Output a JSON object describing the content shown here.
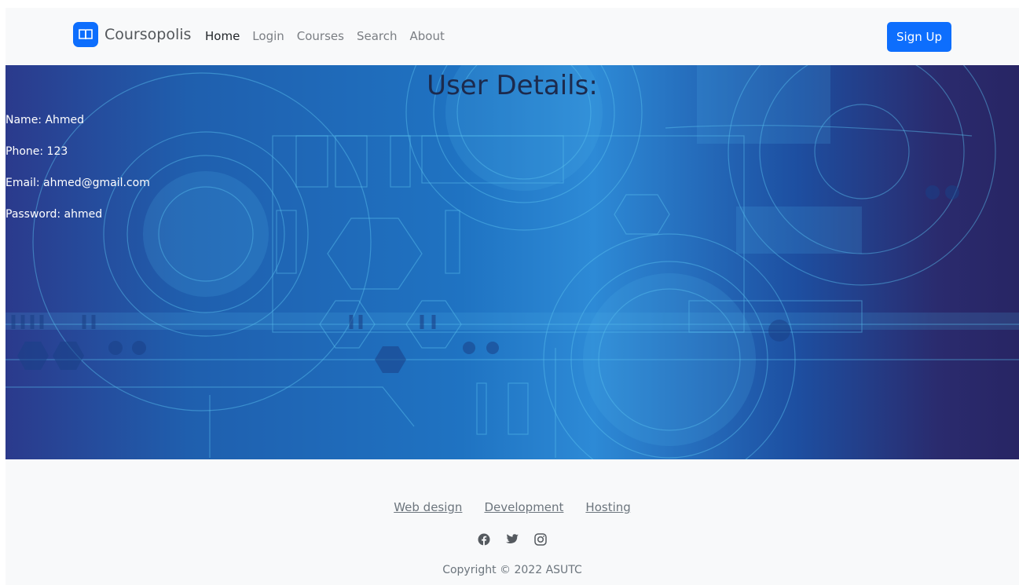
{
  "navbar": {
    "brand": "Coursopolis",
    "brand_icon": "book-icon",
    "links": [
      "Home",
      "Login",
      "Courses",
      "Search",
      "About"
    ],
    "signup_label": "Sign Up"
  },
  "hero": {
    "title": "User Details:",
    "name_line": "Name: Ahmed",
    "phone_line": "Phone: 123",
    "email_line": "Email: ahmed@gmail.com",
    "password_line": "Password: ahmed"
  },
  "footer": {
    "links": [
      "Web design",
      "Development",
      "Hosting"
    ],
    "socials": [
      "facebook-icon",
      "twitter-icon",
      "instagram-icon"
    ],
    "copyright": "Copyright © 2022 ASUTC"
  },
  "colors": {
    "accent": "#0d6efd",
    "nav_bg": "#f8f9fa",
    "hero_dark": "#282564",
    "hero_light": "#2d8ad6",
    "muted_text": "#6c757d"
  }
}
